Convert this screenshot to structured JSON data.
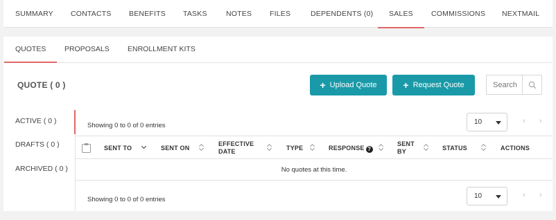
{
  "top_tabs": [
    {
      "label": "SUMMARY"
    },
    {
      "label": "CONTACTS"
    },
    {
      "label": "BENEFITS"
    },
    {
      "label": "TASKS"
    },
    {
      "label": "NOTES"
    },
    {
      "label": "FILES"
    },
    {
      "label": "DEPENDENTS (0)"
    },
    {
      "label": "SALES",
      "active": true
    },
    {
      "label": "COMMISSIONS"
    },
    {
      "label": "NEXTMAIL"
    }
  ],
  "sub_tabs": [
    {
      "label": "QUOTES",
      "active": true
    },
    {
      "label": "PROPOSALS"
    },
    {
      "label": "ENROLLMENT KITS"
    }
  ],
  "quotes": {
    "title": "QUOTE ( 0 )",
    "upload_label": "Upload Quote",
    "request_label": "Request Quote",
    "search_placeholder": "Search"
  },
  "status_list": [
    {
      "label": "ACTIVE ( 0 )",
      "active": true
    },
    {
      "label": "DRAFTS ( 0 )"
    },
    {
      "label": "ARCHIVED ( 0 )"
    }
  ],
  "table": {
    "info_text": "Showing 0 to 0 of 0 entries",
    "page_size": "10",
    "prev": "‹",
    "next": "›",
    "columns": [
      {
        "label": "SENT TO"
      },
      {
        "label": "SENT ON"
      },
      {
        "label": "EFFECTIVE DATE"
      },
      {
        "label": "TYPE"
      },
      {
        "label": "RESPONSE"
      },
      {
        "label": "SENT BY"
      },
      {
        "label": "STATUS"
      },
      {
        "label": "ACTIONS"
      }
    ],
    "empty_text": "No quotes at this time."
  },
  "colors": {
    "accent": "#e06666",
    "button": "#1a9aa8"
  }
}
